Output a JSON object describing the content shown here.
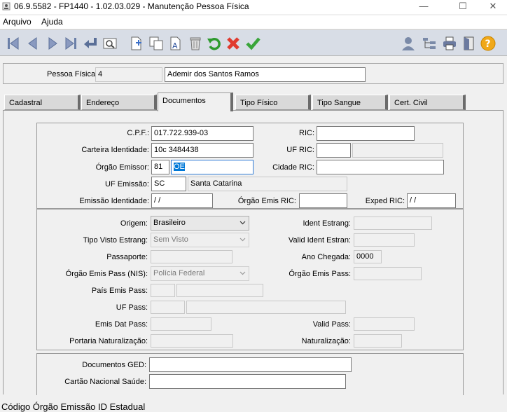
{
  "window": {
    "title": "06.9.5582 - FP1440 - 1.02.03.029 - Manutenção Pessoa Física",
    "minimize": "—",
    "maximize": "☐",
    "close": "✕"
  },
  "menu": {
    "arquivo": "Arquivo",
    "ajuda": "Ajuda"
  },
  "person": {
    "label": "Pessoa Física:",
    "code": "4",
    "name": "Ademir dos Santos Ramos"
  },
  "tabs": [
    "Cadastral",
    "Endereço",
    "Documentos",
    "Tipo Físico",
    "Tipo Sangue",
    "Cert. Civil"
  ],
  "docs": {
    "cpf_label": "C.P.F.:",
    "cpf": "017.722.939-03",
    "ric_label": "RIC:",
    "ric": "",
    "carteira_label": "Carteira Identidade:",
    "carteira": "10c 3484438",
    "uf_ric_label": "UF RIC:",
    "orgao_emissor_label": "Órgão Emissor:",
    "orgao_code": "81",
    "orgao_sigla": "OE",
    "cidade_ric_label": "Cidade RIC:",
    "uf_emissao_label": "UF Emissão:",
    "uf_emissao": "SC",
    "uf_emissao_nome": "Santa Catarina",
    "emissao_identidade_label": "Emissão Identidade:",
    "emissao_identidade": " / /",
    "orgao_emis_ric_label": "Órgão Emis RIC:",
    "exped_ric_label": "Exped RIC:",
    "exped_ric": " / /"
  },
  "foreign": {
    "origem_label": "Origem:",
    "origem": "Brasileiro",
    "ident_estrang_label": "Ident Estrang:",
    "tipo_visto_label": "Tipo Visto Estrang:",
    "tipo_visto": "Sem Visto",
    "valid_ident_label": "Valid Ident Estran:",
    "passaporte_label": "Passaporte:",
    "ano_chegada_label": "Ano Chegada:",
    "ano_chegada": "0000",
    "orgao_emis_pass_nis_label": "Órgão Emis Pass (NIS):",
    "orgao_emis_pass_nis": "Polícia Federal",
    "orgao_emis_pass_label": "Órgão Emis Pass:",
    "pais_emis_pass_label": "País Emis Pass:",
    "uf_pass_label": "UF Pass:",
    "emis_dat_pass_label": "Emis Dat Pass:",
    "valid_pass_label": "Valid Pass:",
    "portaria_label": "Portaria Naturalização:",
    "naturalizacao_label": "Naturalização:"
  },
  "extra": {
    "documentos_ged_label": "Documentos GED:",
    "cartao_sus_label": "Cartão Nacional Saúde:"
  },
  "status": "Código Órgão Emissão ID Estadual",
  "icons": [
    "first-record-icon",
    "prev-record-icon",
    "next-record-icon",
    "last-record-icon",
    "return-icon",
    "search-icon",
    "new-document-icon",
    "copy-icon",
    "edit-text-icon",
    "delete-icon",
    "undo-icon",
    "cancel-icon",
    "confirm-icon",
    "user-icon",
    "tree-icon",
    "print-icon",
    "exit-icon",
    "help-icon"
  ]
}
